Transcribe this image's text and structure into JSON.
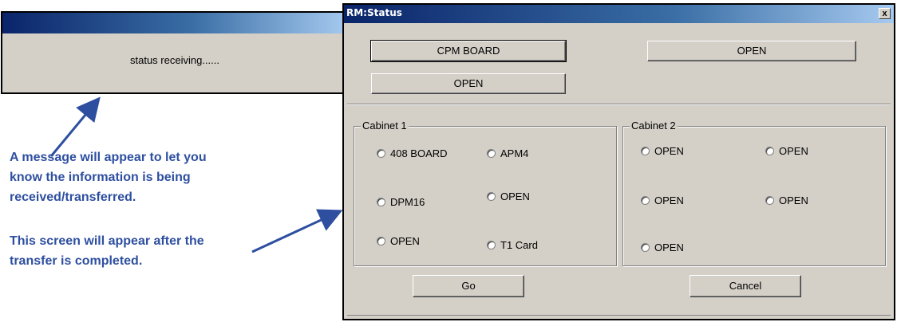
{
  "status_dialog": {
    "message": "status receiving......"
  },
  "annotations": {
    "message_note": [
      "A message will appear to let you",
      "know the information is being",
      "received/transferred."
    ],
    "screen_note": [
      "This screen will appear after the",
      "transfer is completed."
    ]
  },
  "rm_status": {
    "title": "RM:Status",
    "close_label": "x",
    "top_buttons": [
      "CPM BOARD",
      "OPEN",
      "OPEN"
    ],
    "cabinet1": {
      "label": "Cabinet 1",
      "options": [
        "408 BOARD",
        "APM4",
        "DPM16",
        "OPEN",
        "OPEN",
        "T1 Card"
      ]
    },
    "cabinet2": {
      "label": "Cabinet 2",
      "options": [
        "OPEN",
        "OPEN",
        "OPEN",
        "OPEN",
        "OPEN"
      ]
    },
    "go_label": "Go",
    "cancel_label": "Cancel"
  },
  "colors": {
    "annotation": "#2e4fa0",
    "dialog_face": "#d4d0c8",
    "titlebar": "#0a246a"
  }
}
